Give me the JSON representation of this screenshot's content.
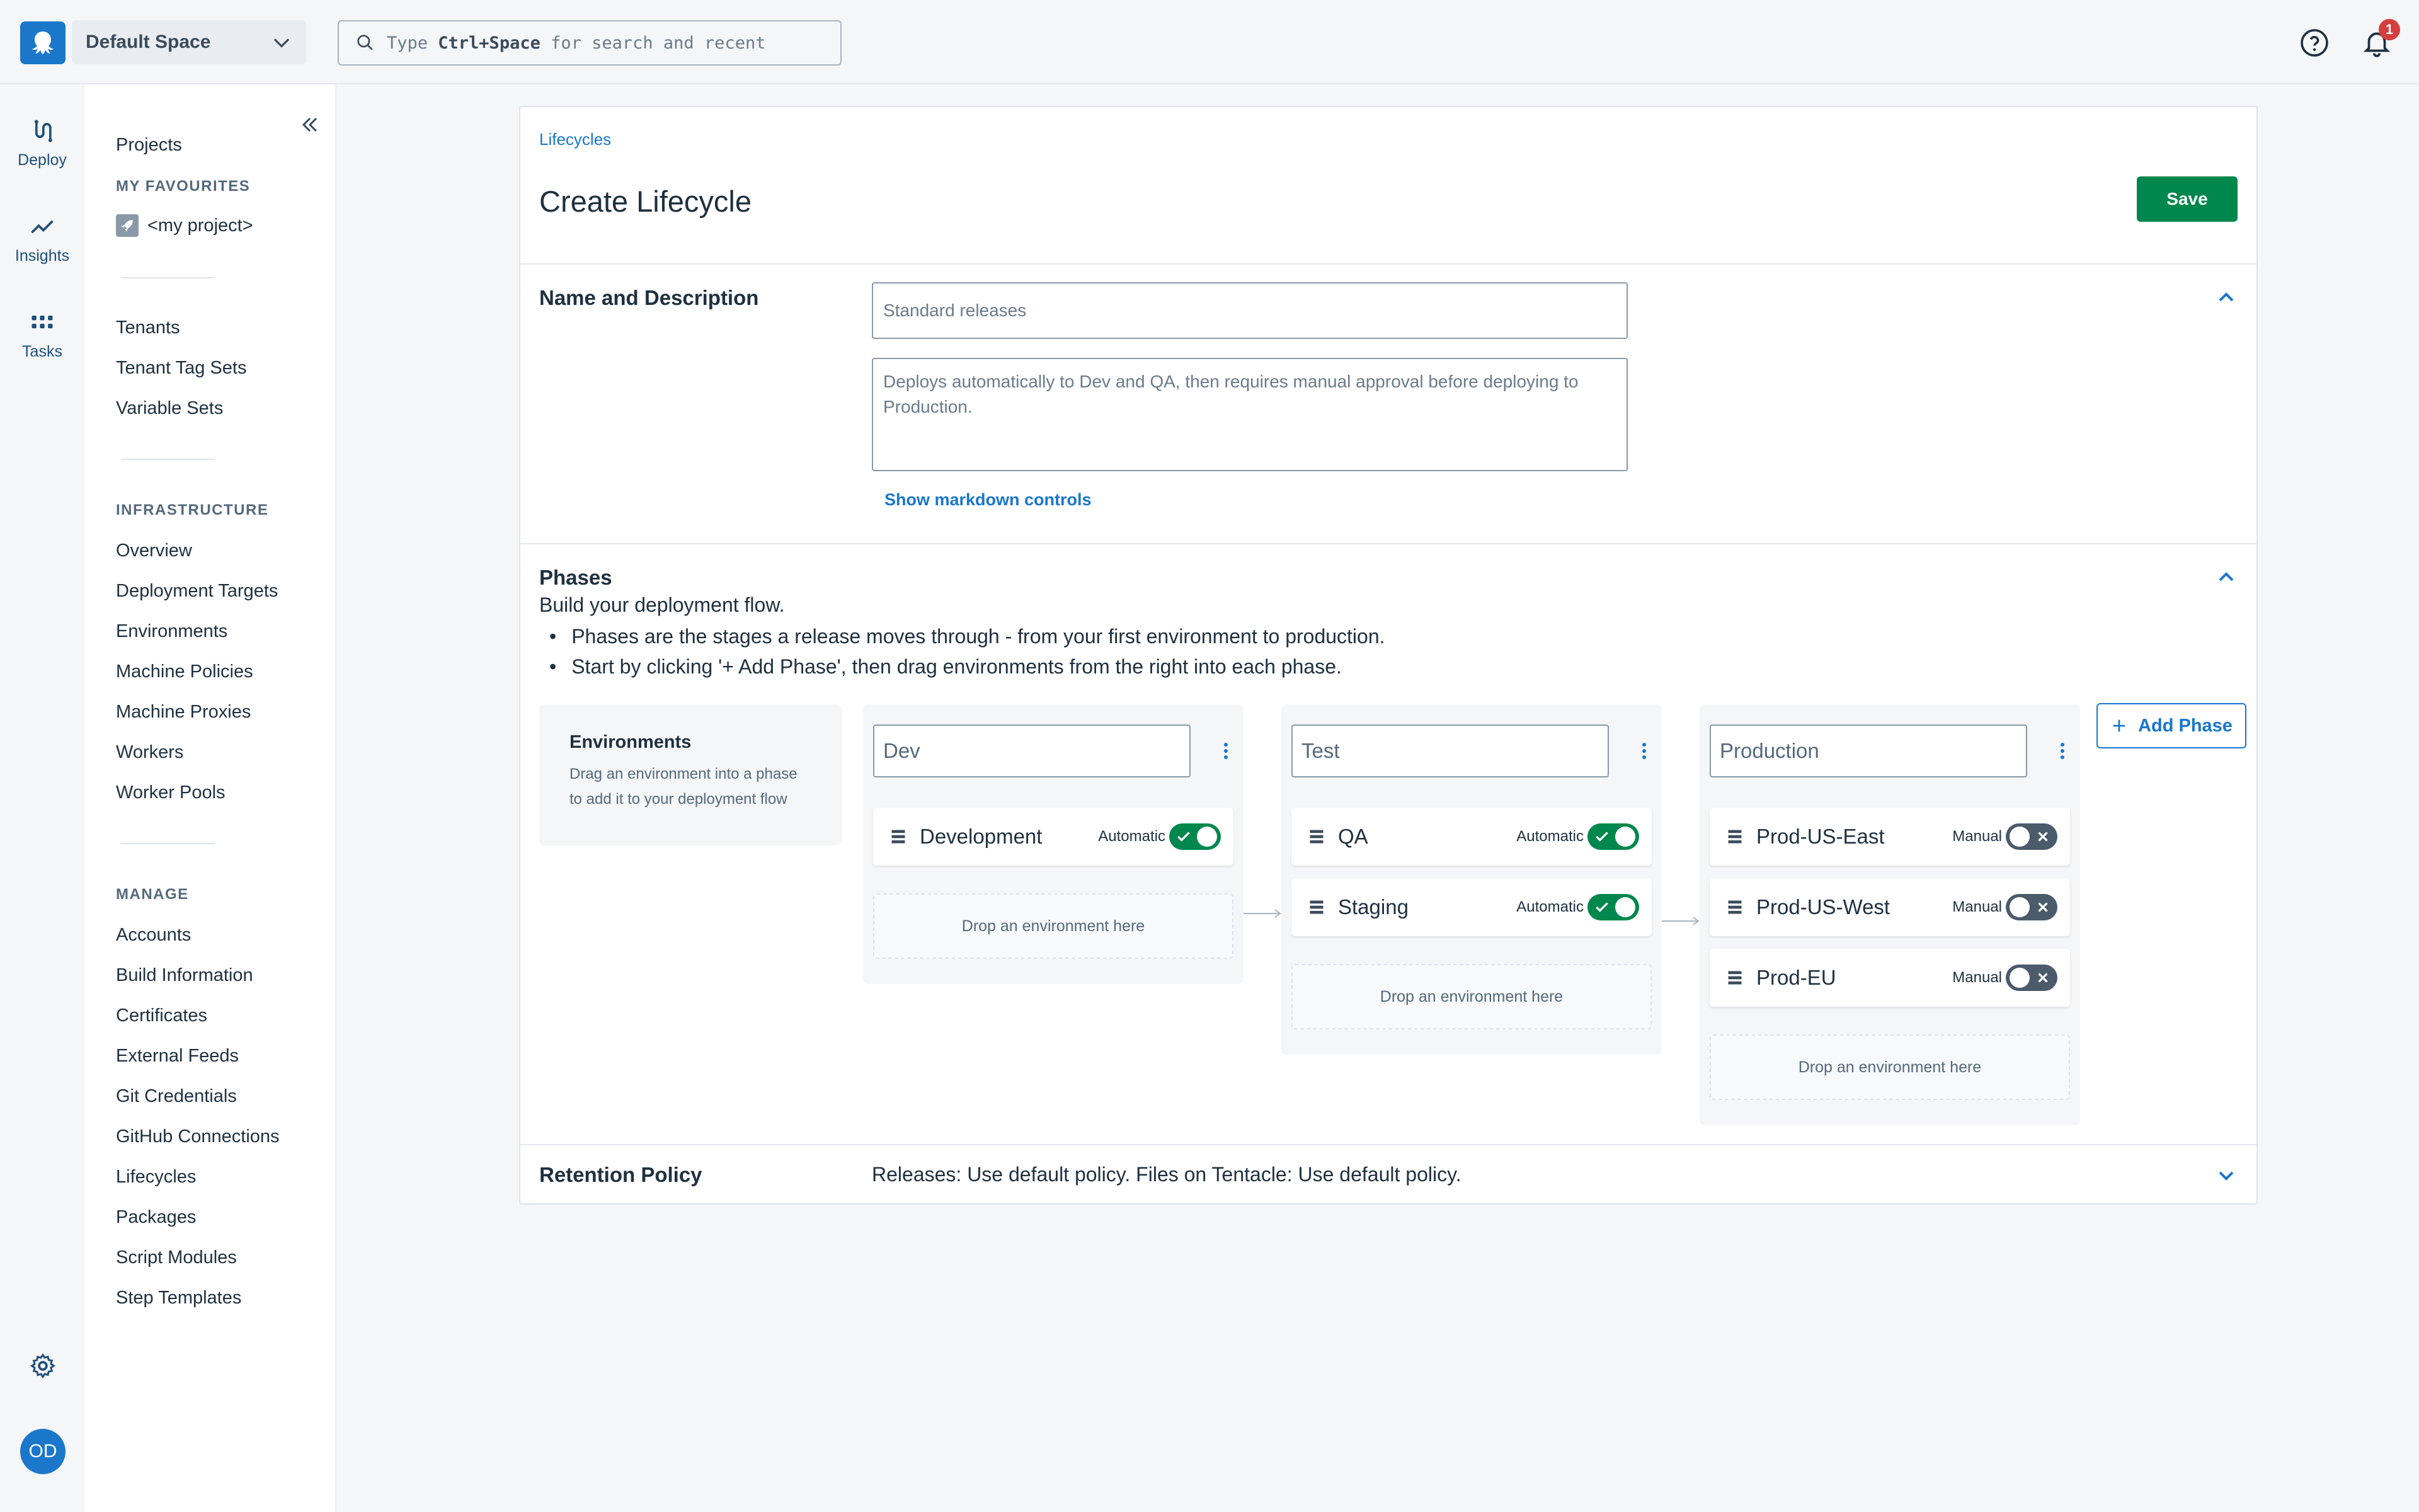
{
  "header": {
    "space_name": "Default Space",
    "search_prefix": "Type ",
    "search_shortcut": "Ctrl+Space",
    "search_suffix": " for search and recent",
    "notification_count": "1"
  },
  "rail": {
    "deploy": "Deploy",
    "insights": "Insights",
    "tasks": "Tasks",
    "avatar_initials": "OD"
  },
  "sidebar": {
    "projects": "Projects",
    "favourites_heading": "MY FAVOURITES",
    "favourite_project": "<my project>",
    "group1": [
      "Tenants",
      "Tenant Tag Sets",
      "Variable Sets"
    ],
    "infrastructure_heading": "INFRASTRUCTURE",
    "infrastructure": [
      "Overview",
      "Deployment Targets",
      "Environments",
      "Machine Policies",
      "Machine Proxies",
      "Workers",
      "Worker Pools"
    ],
    "manage_heading": "MANAGE",
    "manage": [
      "Accounts",
      "Build Information",
      "Certificates",
      "External Feeds",
      "Git Credentials",
      "GitHub Connections",
      "Lifecycles",
      "Packages",
      "Script Modules",
      "Step Templates"
    ]
  },
  "main": {
    "breadcrumb": "Lifecycles",
    "title": "Create Lifecycle",
    "save_label": "Save",
    "name_section_title": "Name and Description",
    "name_placeholder": "Standard releases",
    "description_placeholder": "Deploys automatically to Dev and QA, then requires manual approval before deploying to Production.",
    "show_markdown": "Show markdown controls",
    "phases_title": "Phases",
    "phases_intro": "Build your deployment flow.",
    "phases_bullets": [
      "Phases are the stages a release moves through - from your first environment to production.",
      "Start by clicking '+ Add Phase', then drag environments from the right into each phase."
    ],
    "env_panel_title": "Environments",
    "env_panel_desc": "Drag an environment into a phase to add it to your deployment flow",
    "add_phase_label": "Add Phase",
    "drop_label": "Drop an environment here",
    "phases": [
      {
        "name": "Dev",
        "environments": [
          {
            "name": "Development",
            "mode": "Automatic",
            "enabled": true
          }
        ]
      },
      {
        "name": "Test",
        "environments": [
          {
            "name": "QA",
            "mode": "Automatic",
            "enabled": true
          },
          {
            "name": "Staging",
            "mode": "Automatic",
            "enabled": true
          }
        ]
      },
      {
        "name": "Production",
        "environments": [
          {
            "name": "Prod-US-East",
            "mode": "Manual",
            "enabled": false
          },
          {
            "name": "Prod-US-West",
            "mode": "Manual",
            "enabled": false
          },
          {
            "name": "Prod-EU",
            "mode": "Manual",
            "enabled": false
          }
        ]
      }
    ],
    "retention_title": "Retention Policy",
    "retention_text": "Releases: Use default policy. Files on Tentacle: Use default policy."
  },
  "colors": {
    "brand": "#1a77ca",
    "save": "#00874d",
    "toggle_on": "#00874d",
    "toggle_off": "#4b5b6b",
    "badge": "#d63d3d"
  }
}
